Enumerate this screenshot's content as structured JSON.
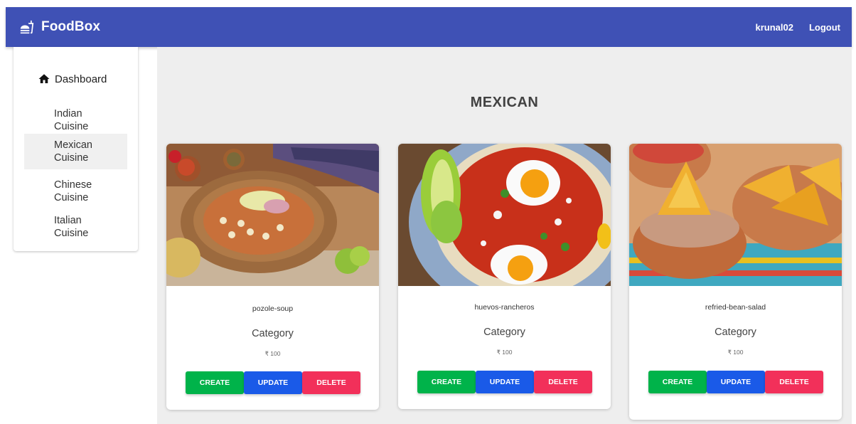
{
  "appbar": {
    "brand": "FoodBox",
    "brand_icon": "fastfood-icon",
    "username": "krunal02",
    "logout": "Logout",
    "color": "#3f51b5"
  },
  "sidebar": {
    "dashboard": "Dashboard",
    "dashboard_icon": "home-icon",
    "items": [
      {
        "label": "Indian\nCuisine",
        "active": false
      },
      {
        "label": "Mexican\nCuisine",
        "active": true
      },
      {
        "label": "Chinese\nCuisine",
        "active": false
      },
      {
        "label": "Italian\nCuisine",
        "active": false
      }
    ]
  },
  "main": {
    "title": "MEXICAN",
    "cards": [
      {
        "name": "pozole-soup",
        "category": "Category",
        "price": "₹ 100"
      },
      {
        "name": "huevos-rancheros",
        "category": "Category",
        "price": "₹ 100"
      },
      {
        "name": "refried-bean-salad",
        "category": "Category",
        "price": "₹ 100"
      }
    ],
    "buttons": {
      "create": "CREATE",
      "update": "UPDATE",
      "delete": "DELETE"
    },
    "colors": {
      "create": "#00b34a",
      "update": "#1a5ae8",
      "delete": "#f2305a"
    }
  }
}
